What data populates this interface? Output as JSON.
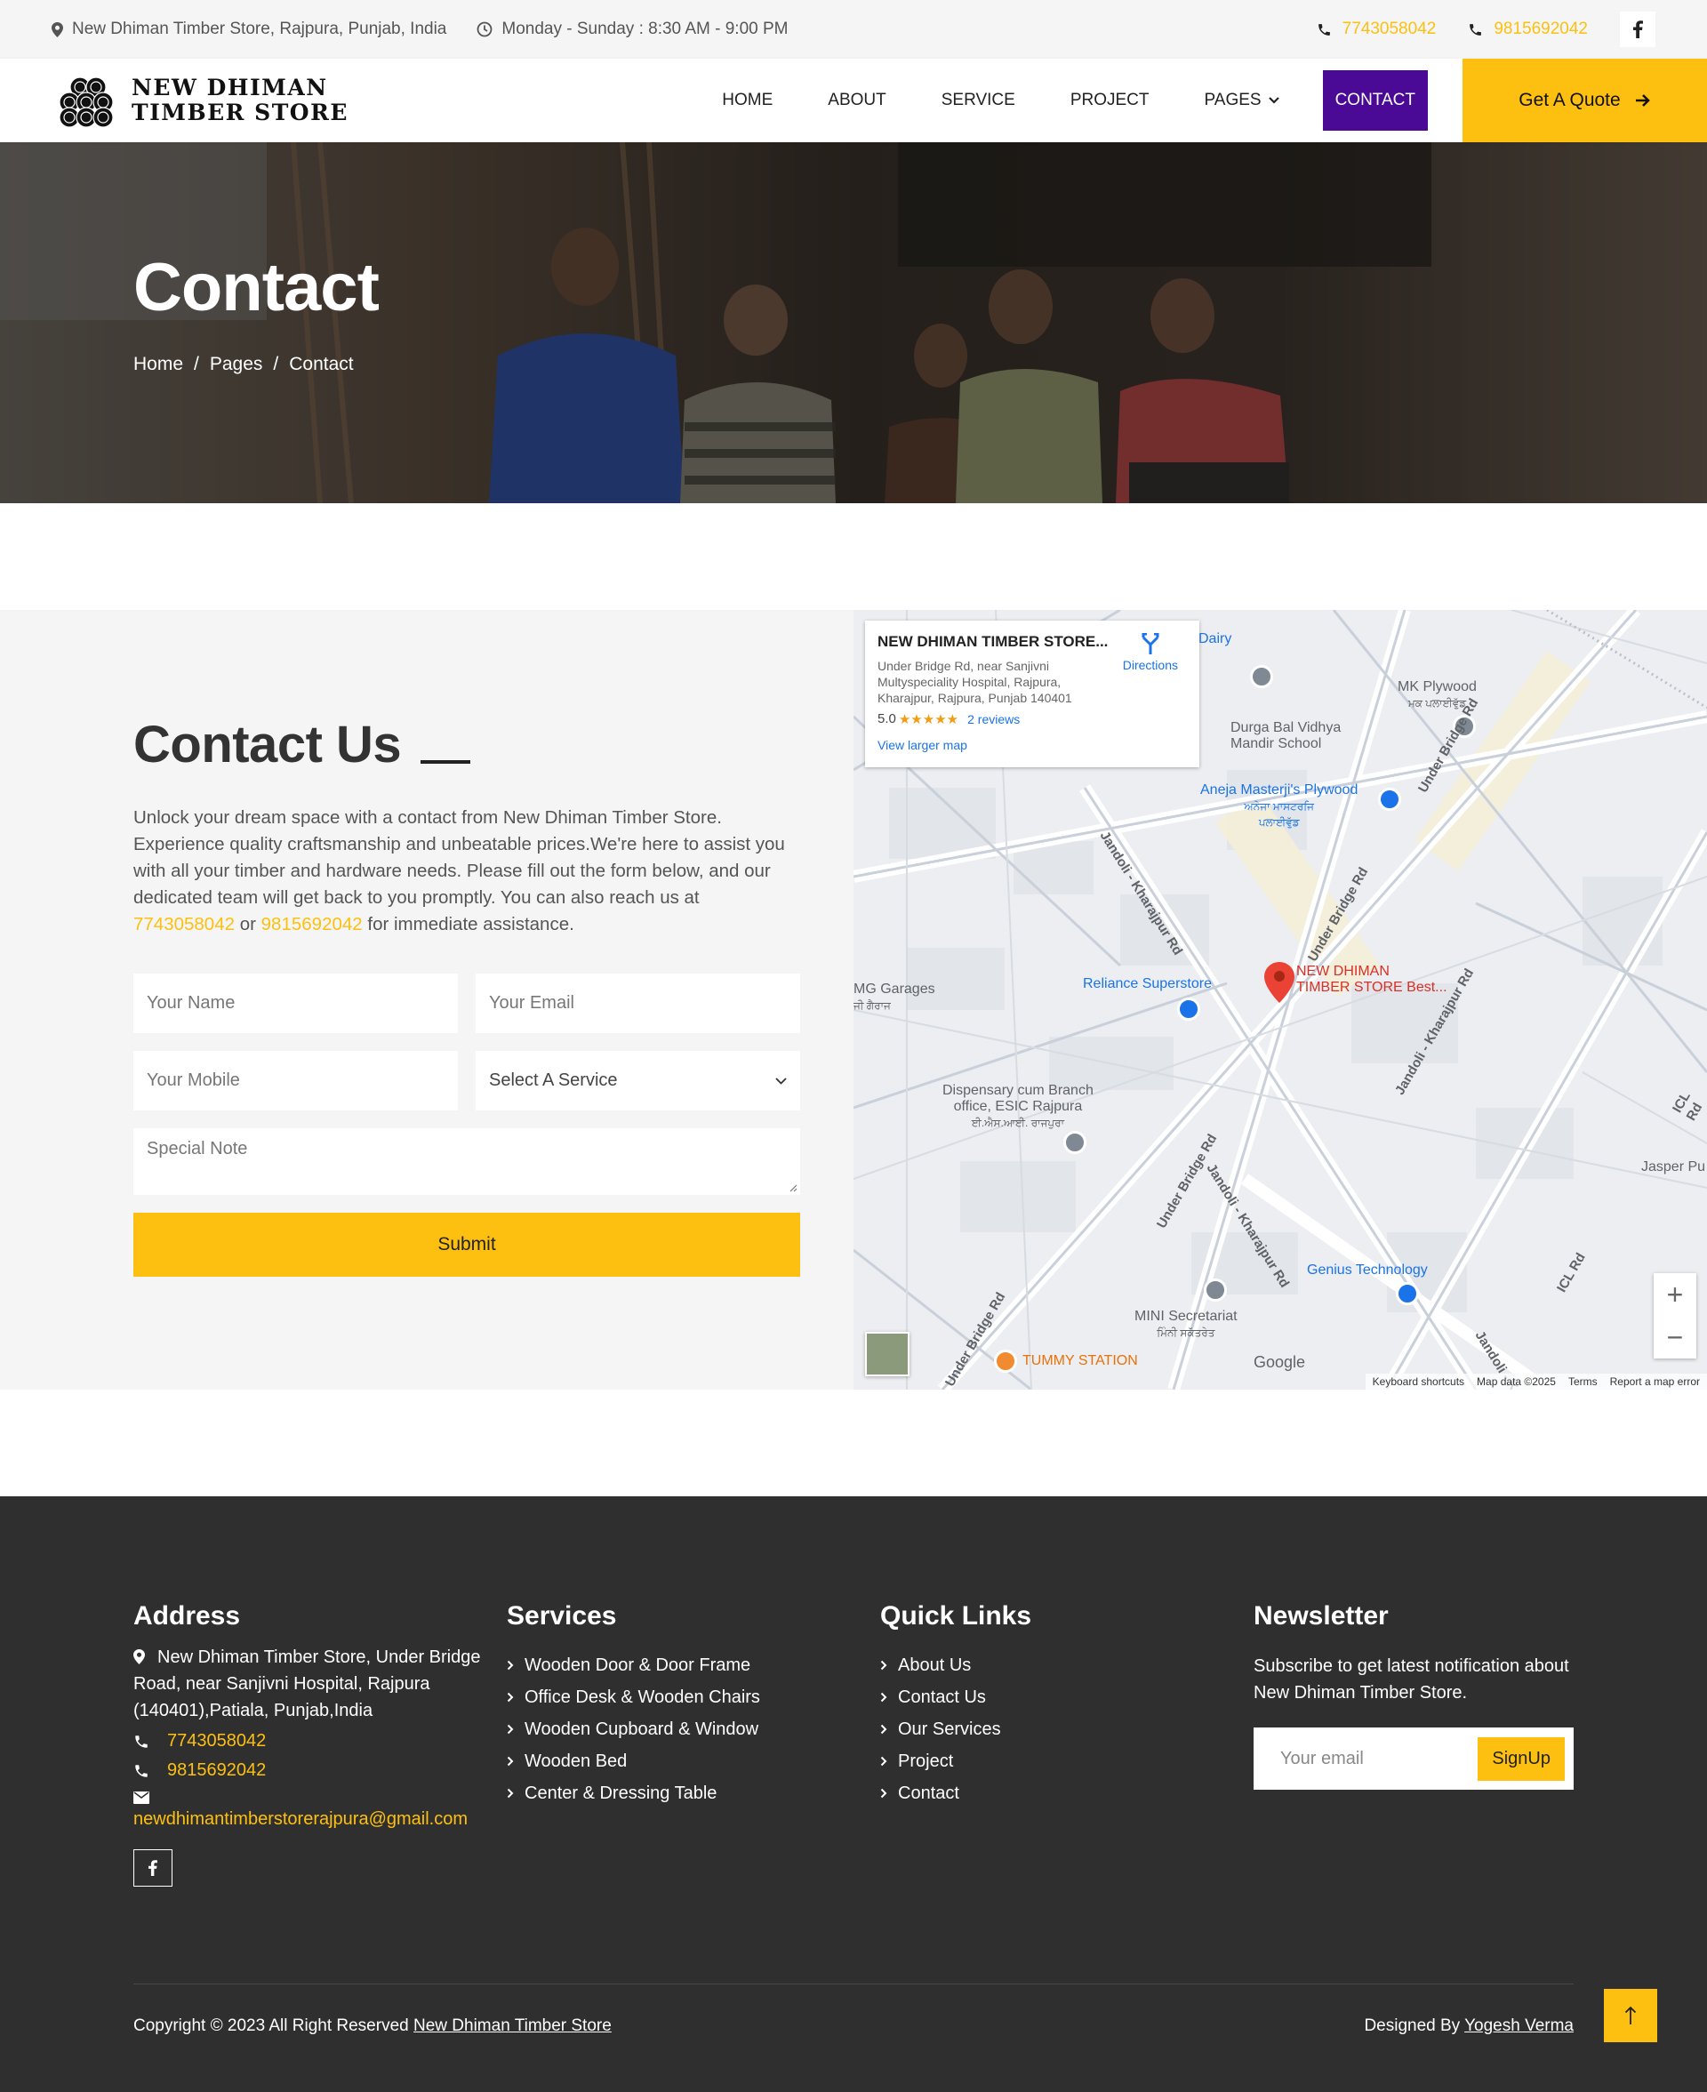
{
  "topbar": {
    "address": "New Dhiman Timber Store, Rajpura, Punjab, India",
    "hours": "Monday - Sunday : 8:30 AM - 9:00 PM",
    "phone1": "7743058042",
    "phone2": "9815692042"
  },
  "nav": {
    "logo_line1": "NEW DHIMAN",
    "logo_line2": "TIMBER STORE",
    "items": [
      "HOME",
      "ABOUT",
      "SERVICE",
      "PROJECT",
      "PAGES",
      "CONTACT"
    ],
    "quote_label": "Get A Quote"
  },
  "hero": {
    "title": "Contact",
    "breadcrumb": [
      "Home",
      "/",
      "Pages",
      "/",
      "Contact"
    ]
  },
  "contact": {
    "title": "Contact Us",
    "text_before": "Unlock your dream space with a contact from New Dhiman Timber Store. Experience quality craftsmanship and unbeatable prices.We're here to assist you with all your timber and hardware needs. Please fill out the form below, and our dedicated team will get back to you promptly. You can also reach us at",
    "phone1": "7743058042",
    "or": "or",
    "phone2": "9815692042",
    "text_after": "for immediate assistance.",
    "form": {
      "name_placeholder": "Your Name",
      "email_placeholder": "Your Email",
      "mobile_placeholder": "Your Mobile",
      "service_selected": "Select A Service",
      "note_placeholder": "Special Note",
      "submit_label": "Submit"
    }
  },
  "map": {
    "card_title": "NEW DHIMAN TIMBER STORE...",
    "card_address": "Under Bridge Rd, near Sanjivni Multyspeciality Hospital, Rajpura, Kharajpur, Rajpura, Punjab 140401",
    "rating": "5.0",
    "stars": "★★★★★",
    "reviews": "2 reviews",
    "view_larger": "View larger map",
    "directions": "Directions",
    "labels": {
      "dairy": "Dairy",
      "mk_plywood": "MK Plywood",
      "mk_plywood_pa": "ਮਕ ਪਲਾਈਵੁੱਡ",
      "durga": "Durga Bal Vidhya",
      "durga2": "Mandir School",
      "aneja": "Aneja Masterji's Plywood",
      "aneja_pa": "ਅਨੇਜਾ ਮਾਸਟਰਜਿ",
      "aneja_pa2": "ਪਲਾਈਵੁੱਡ",
      "under_bridge": "Under Bridge Rd",
      "jandoli": "Jandoli - Kharajpur Rd",
      "reliance": "Reliance Superstore",
      "pin1": "NEW DHIMAN",
      "pin2": "TIMBER STORE Best...",
      "mg": "MG Garages",
      "mg_pa": "ਜੀ ਗੈਰਾਜ",
      "disp1": "Dispensary cum Branch",
      "disp2": "office, ESIC Rajpura",
      "disp3": "ਈ.ਐਸ.ਆਈ. ਰਾਜਪੁਰਾ",
      "icl": "ICL Rd",
      "jasper": "Jasper Pu",
      "genius": "Genius Technology",
      "mini1": "MINI Secretariat",
      "mini2": "ਮਿੰਨੀ ਸਕੱਤਰੇਤ",
      "tummy": "TUMMY STATION",
      "jandoli_k": "Jandoli - K"
    },
    "footer": [
      "Keyboard shortcuts",
      "Map data ©2025",
      "Terms",
      "Report a map error"
    ],
    "google": "Google"
  },
  "footer": {
    "address_title": "Address",
    "address_text": "New Dhiman Timber Store, Under Bridge Road, near Sanjivni Hospital, Rajpura (140401),Patiala, Punjab,India",
    "phone1": "7743058042",
    "phone2": "9815692042",
    "email": "newdhimantimberstorerajpura@gmail.com",
    "services_title": "Services",
    "services": [
      "Wooden Door & Door Frame",
      "Office Desk & Wooden Chairs",
      "Wooden Cupboard & Window",
      "Wooden Bed",
      "Center & Dressing Table"
    ],
    "links_title": "Quick Links",
    "links": [
      "About Us",
      "Contact Us",
      "Our Services",
      "Project",
      "Contact"
    ],
    "newsletter_title": "Newsletter",
    "newsletter_text": "Subscribe to get latest notification about New Dhiman Timber Store.",
    "email_placeholder": "Your email",
    "signup_label": "SignUp",
    "copyright_prefix": "Copyright © 2023 All Right Reserved",
    "copyright_link": "New Dhiman Timber Store",
    "designed_prefix": "Designed By",
    "designed_link": "Yogesh Verma"
  },
  "colors": {
    "accent": "#fdc010",
    "contact_active": "#4b0a96",
    "footer_bg": "#2f2f2f"
  }
}
